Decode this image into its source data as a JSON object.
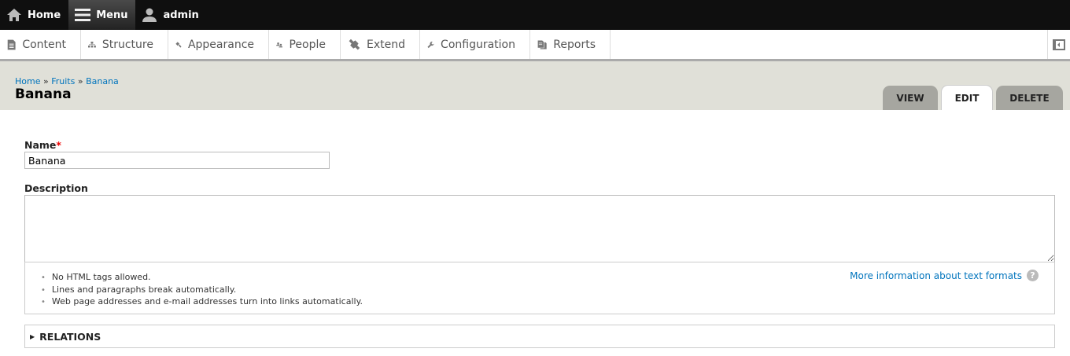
{
  "toolbar": {
    "home": "Home",
    "menu": "Menu",
    "user": "admin"
  },
  "tray": [
    {
      "label": "Content",
      "icon": "document-icon"
    },
    {
      "label": "Structure",
      "icon": "sitemap-icon"
    },
    {
      "label": "Appearance",
      "icon": "paintbrush-icon"
    },
    {
      "label": "People",
      "icon": "people-icon"
    },
    {
      "label": "Extend",
      "icon": "plug-icon"
    },
    {
      "label": "Configuration",
      "icon": "wrench-icon"
    },
    {
      "label": "Reports",
      "icon": "report-icon"
    }
  ],
  "breadcrumb": [
    "Home",
    "Fruits",
    "Banana"
  ],
  "page_title": "Banana",
  "tabs": [
    "VIEW",
    "EDIT",
    "DELETE"
  ],
  "form": {
    "name_label": "Name",
    "required": "*",
    "name_value": "Banana",
    "description_label": "Description",
    "help": [
      "No HTML tags allowed.",
      "Lines and paragraphs break automatically.",
      "Web page addresses and e-mail addresses turn into links automatically."
    ],
    "more_info": "More information about text formats",
    "relations": "RELATIONS"
  }
}
